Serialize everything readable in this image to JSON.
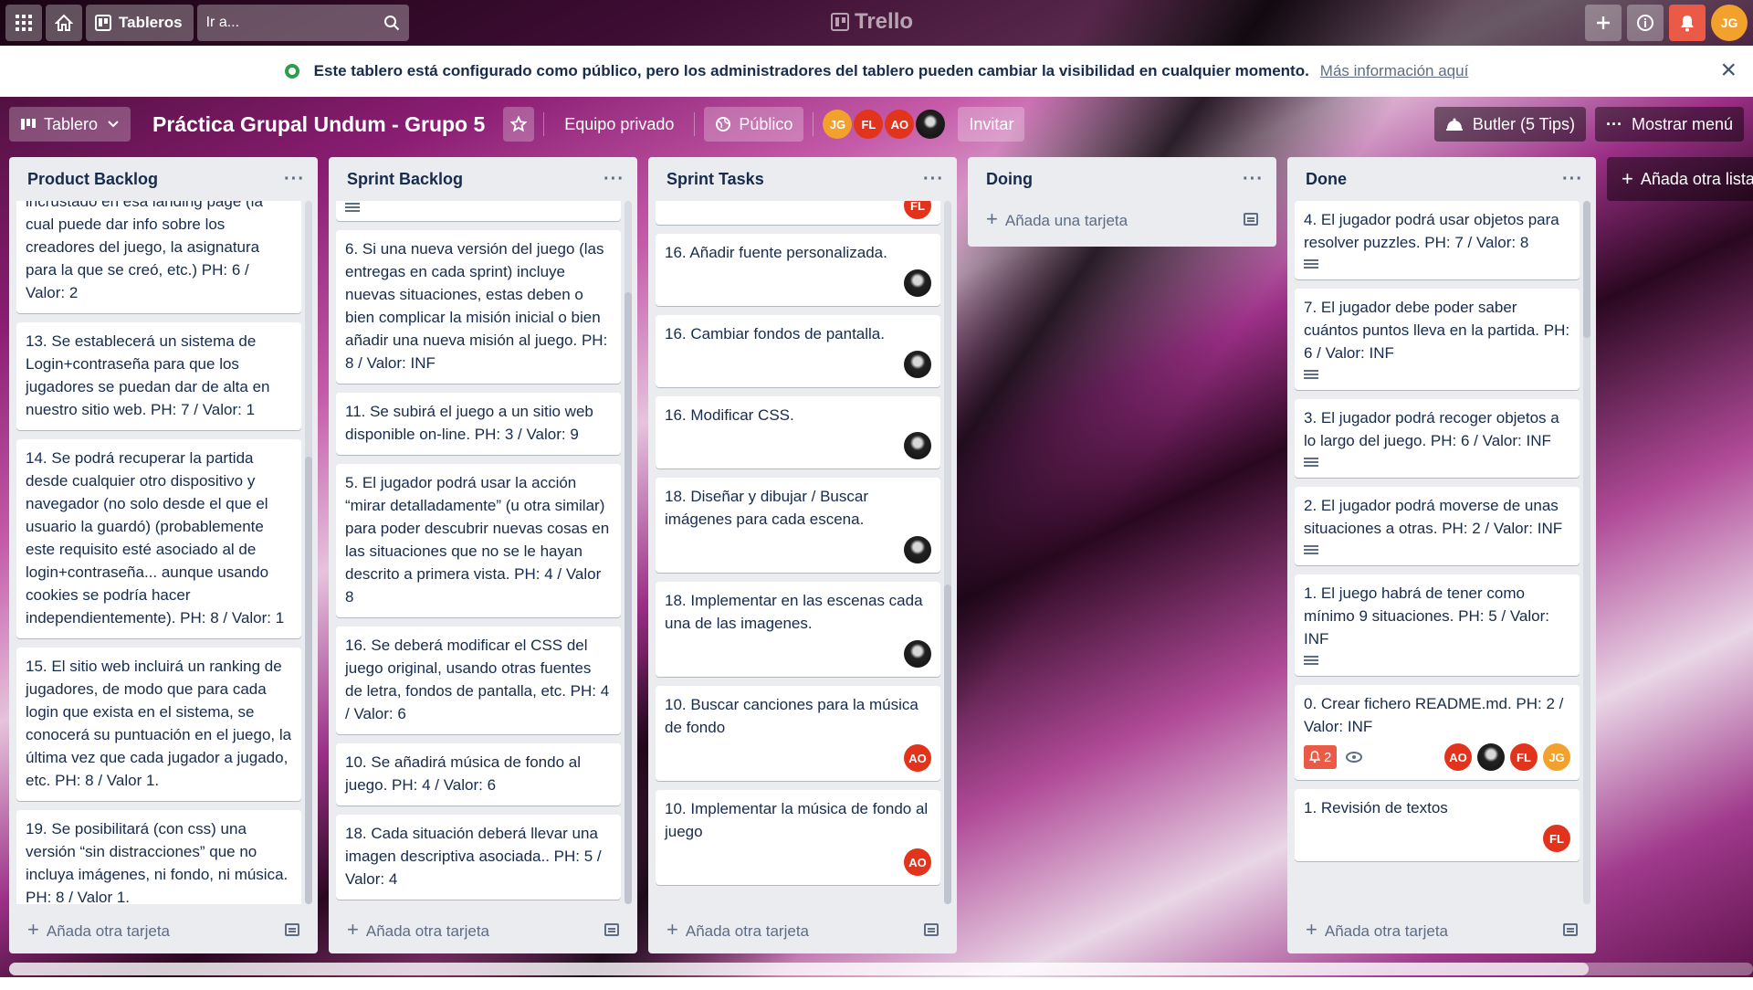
{
  "header": {
    "boards_label": "Tableros",
    "search_placeholder": "Ir a...",
    "logo": "Trello",
    "user_initials": "JG"
  },
  "banner": {
    "text": "Este tablero está configurado como público, pero los administradores del tablero pueden cambiar la visibilidad en cualquier momento.",
    "link": "Más información aquí"
  },
  "board": {
    "view_label": "Tablero",
    "title": "Práctica Grupal Undum - Grupo 5",
    "team_label": "Equipo privado",
    "visibility_label": "Público",
    "members": [
      "JG",
      "FL",
      "AO"
    ],
    "invite_label": "Invitar",
    "butler_label": "Butler (5 Tips)",
    "menu_label": "Mostrar menú"
  },
  "lists": {
    "product_backlog": {
      "title": "Product Backlog",
      "cards": [
        "incrustado en esa landing page (la cual puede dar info sobre los creadores del juego, la asignatura para la que se creó, etc.) PH: 6 / Valor: 2",
        "13. Se establecerá un sistema de Login+contraseña para que los jugadores se puedan dar de alta en nuestro sitio web. PH: 7 / Valor: 1",
        "14. Se podrá recuperar la partida desde cualquier otro dispositivo y navegador (no solo desde el que el usuario la guardó) (probablemente este requisito esté asociado al de login+contraseña... aunque usando cookies se podría hacer independientemente). PH: 8 / Valor: 1",
        "15. El sitio web incluirá un ranking de jugadores, de modo que para cada login que exista en el sistema, se conocerá su puntuación en el juego, la última vez que cada jugador a jugado, etc. PH: 8 / Valor 1.",
        "19. Se posibilitará (con css) una versión “sin distracciones” que no incluya imágenes, ni fondo, ni música. PH: 8 / Valor 1."
      ],
      "add_card": "Añada otra tarjeta"
    },
    "sprint_backlog": {
      "title": "Sprint Backlog",
      "cards": [
        "6. Si una nueva versión del juego (las entregas en cada sprint) incluye nuevas situaciones, estas deben o bien complicar la misión inicial o bien añadir una nueva misión al juego. PH: 8 / Valor: INF",
        "11. Se subirá el juego a un sitio web disponible on-line. PH: 3 / Valor: 9",
        "5. El jugador podrá usar la acción “mirar detalladamente” (u otra similar) para poder descubrir nuevas cosas en las situaciones que no se le hayan descrito a primera vista. PH: 4 / Valor 8",
        "16. Se deberá modificar el CSS del juego original, usando otras fuentes de letra, fondos de pantalla, etc. PH: 4 / Valor: 6",
        "10. Se añadirá música de fondo al juego. PH: 4 / Valor: 6",
        "18. Cada situación deberá llevar una imagen descriptiva asociada.. PH: 5 / Valor: 4"
      ],
      "add_card": "Añada otra tarjeta"
    },
    "sprint_tasks": {
      "title": "Sprint Tasks",
      "first_card_member": "FL",
      "cards": [
        {
          "text": "16. Añadir fuente personalizada.",
          "member": "photo"
        },
        {
          "text": "16. Cambiar fondos de pantalla.",
          "member": "photo"
        },
        {
          "text": "16. Modificar CSS.",
          "member": "photo"
        },
        {
          "text": "18. Diseñar y dibujar / Buscar imágenes para cada escena.",
          "member": "photo"
        },
        {
          "text": "18. Implementar en las escenas cada una de las imagenes.",
          "member": "photo"
        },
        {
          "text": "10. Buscar canciones para la música de fondo",
          "member": "AO"
        },
        {
          "text": "10. Implementar la música de fondo al juego",
          "member": "AO"
        }
      ],
      "add_card": "Añada otra tarjeta"
    },
    "doing": {
      "title": "Doing",
      "add_card": "Añada una tarjeta"
    },
    "done": {
      "title": "Done",
      "cards": [
        "4. El jugador podrá usar objetos para resolver puzzles. PH: 7 / Valor: 8",
        "7. El jugador debe poder saber cuántos puntos lleva en la partida. PH: 6 / Valor: INF",
        "3. El jugador podrá recoger objetos a lo largo del juego. PH: 6 / Valor: INF",
        "2. El jugador podrá moverse de unas situaciones a otras. PH: 2 / Valor: INF",
        "1. El juego habrá de tener como mínimo 9 situaciones. PH: 5 / Valor: INF",
        "0. Crear fichero README.md. PH: 2 / Valor: INF",
        "1. Revisión de textos"
      ],
      "readme_notifications": "2",
      "readme_members": [
        "AO",
        "photo",
        "FL",
        "JG"
      ],
      "last_card_member": "FL",
      "add_card": "Añada otra tarjeta"
    },
    "add_list": "Añada otra lista"
  },
  "colors": {
    "accent_red": "#eb5a46",
    "member_orange": "#f2a12c",
    "member_red": "#e2341d",
    "list_bg": "#ebecf0"
  }
}
